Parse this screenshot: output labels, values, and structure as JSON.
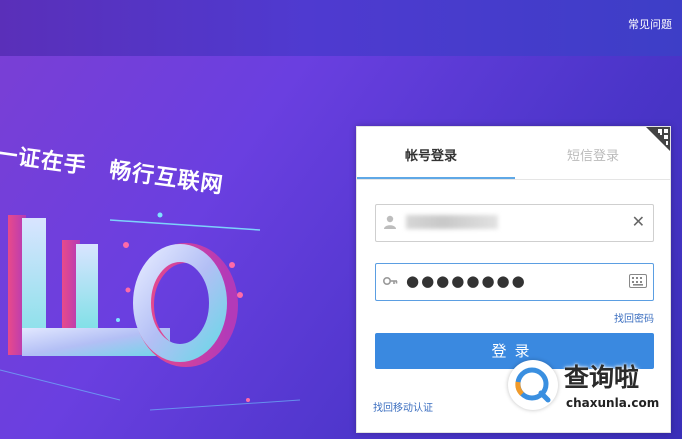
{
  "header": {
    "faq_label": "常见问题"
  },
  "hero": {
    "slogan": "一证在手　畅行互联网"
  },
  "login_panel": {
    "tabs": [
      {
        "label": "帐号登录",
        "active": true
      },
      {
        "label": "短信登录",
        "active": false
      }
    ],
    "username": {
      "value": ""
    },
    "password": {
      "value": "●●●●●●●●"
    },
    "forgot_password": "找回密码",
    "login_button": "登录",
    "recover_mobile_auth": "找回移动认证"
  },
  "watermark": {
    "name": "查询啦",
    "domain": "chaxunla.com"
  },
  "colors": {
    "accent": "#3a89e0",
    "link": "#3c6fc0",
    "tab_underline": "#5fa8e6"
  }
}
